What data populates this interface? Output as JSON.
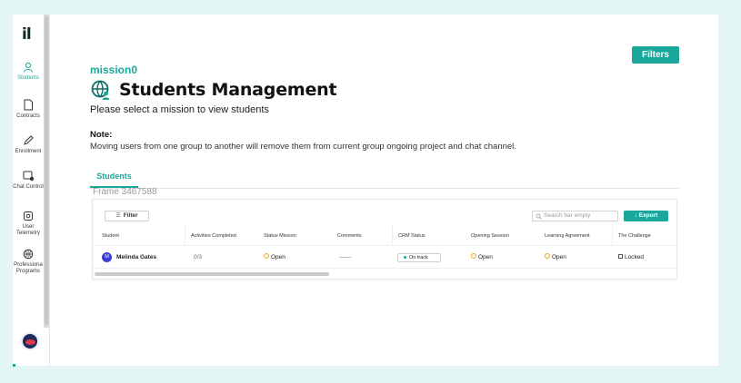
{
  "sidebar": {
    "logo": "il",
    "items": [
      {
        "label": "Students",
        "icon": "user-icon",
        "active": true
      },
      {
        "label": "Contracts",
        "icon": "document-icon",
        "active": false
      },
      {
        "label": "Enrollment",
        "icon": "pen-icon",
        "active": false
      },
      {
        "label": "Chat Control",
        "icon": "chat-gear-icon",
        "active": false
      },
      {
        "label": "User Telemetry",
        "icon": "telemetry-icon",
        "active": false
      },
      {
        "label": "Professiona Programs",
        "icon": "basketball-icon",
        "active": false
      }
    ]
  },
  "header": {
    "filters_label": "Filters",
    "mission": "mission0",
    "title": "Students Management",
    "subtitle": "Please select a mission to view students",
    "note_heading": "Note:",
    "note_text": "Moving users from one group to another will remove them from current group ongoing project and chat channel."
  },
  "tabs": [
    {
      "label": "Students"
    }
  ],
  "frame_label": "Frame 3467588",
  "table": {
    "filter_label": "Filter",
    "search_placeholder": "Search bar empty",
    "export_label": "Export",
    "columns": [
      "Student",
      "Activities Completed",
      "Status Mission",
      "Comments",
      "CRM Status",
      "Opening Session",
      "Learning Agreement",
      "The Challenge"
    ],
    "rows": [
      {
        "avatar": "M",
        "student": "Melinda Gates",
        "activities": "0/3",
        "status_mission": "Open",
        "comments": "------",
        "crm_status": "On track",
        "opening_session": "Open",
        "learning_agreement": "Open",
        "challenge": "Locked"
      }
    ]
  },
  "colors": {
    "accent": "#1aa79b",
    "background": "#e3f6f3",
    "avatar": "#3d3fd1",
    "pending": "#e9a81a"
  }
}
